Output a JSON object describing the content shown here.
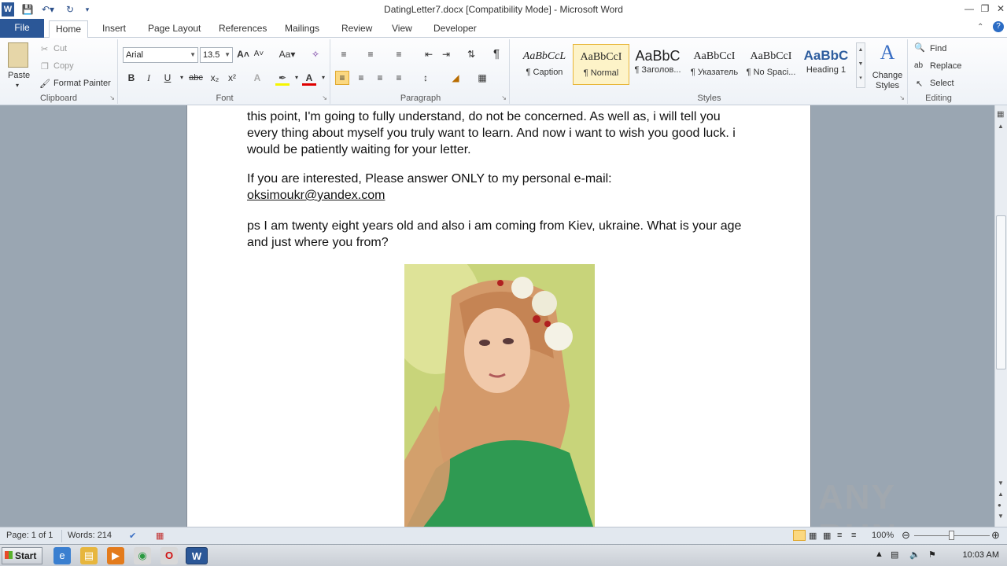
{
  "window": {
    "title": "DatingLetter7.docx [Compatibility Mode] - Microsoft Word"
  },
  "tabs": [
    "File",
    "Home",
    "Insert",
    "Page Layout",
    "References",
    "Mailings",
    "Review",
    "View",
    "Developer"
  ],
  "clipboard": {
    "paste": "Paste",
    "cut": "Cut",
    "copy": "Copy",
    "format_painter": "Format Painter",
    "label": "Clipboard"
  },
  "font": {
    "name": "Arial",
    "size": "13.5",
    "label": "Font",
    "change_case": "Aa"
  },
  "paragraph": {
    "label": "Paragraph"
  },
  "styles": {
    "items": [
      {
        "preview": "AaBbCcL",
        "name": "¶ Caption"
      },
      {
        "preview": "AaBbCcI",
        "name": "¶ Normal"
      },
      {
        "preview": "AaBbC",
        "name": "¶ Заголов..."
      },
      {
        "preview": "AaBbCcI",
        "name": "¶ Указатель"
      },
      {
        "preview": "AaBbCcI",
        "name": "¶ No Spaci..."
      },
      {
        "preview": "AaBbC",
        "name": "Heading 1"
      }
    ],
    "change_styles": "Change Styles",
    "label": "Styles"
  },
  "editing": {
    "find": "Find",
    "replace": "Replace",
    "select": "Select",
    "label": "Editing"
  },
  "document": {
    "para1": "this point, I'm  going to fully understand, do not be concerned. As well as, i will tell you every thing about myself you truly want to learn. And now i want to wish you good luck. i would be patiently waiting for your letter.",
    "para2_prefix": "If you are interested, Please answer ONLY to my personal e-mail: ",
    "para2_email": "oksimoukr@yandex.com",
    "para3": "ps I am twenty eight years old and also i am coming from Kiev, ukraine. What is your age and just where you from?"
  },
  "status": {
    "page": "Page: 1 of 1",
    "words": "Words: 214",
    "zoom": "100%"
  },
  "taskbar": {
    "start": "Start",
    "clock": "10:03 AM"
  },
  "watermark": "ANY RUN"
}
